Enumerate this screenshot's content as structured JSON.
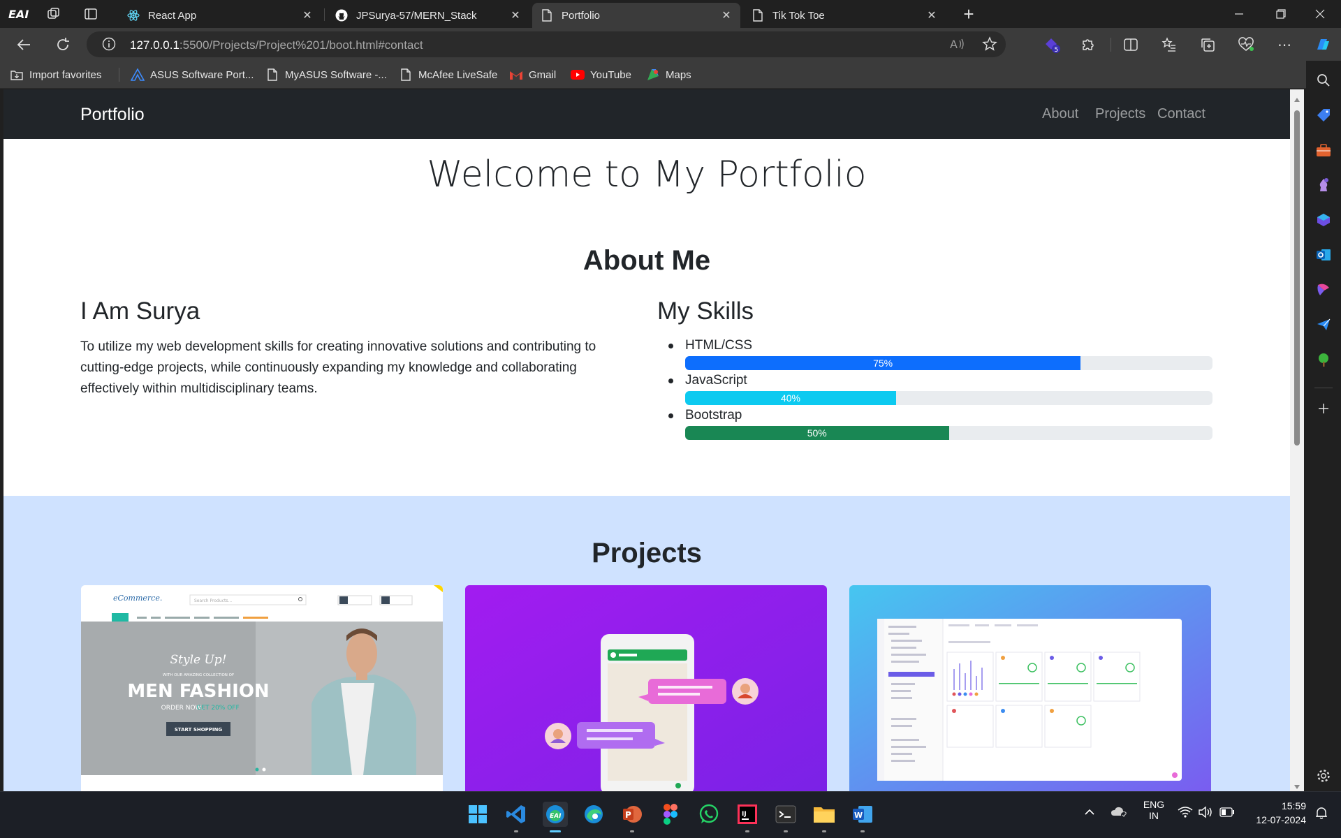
{
  "browser": {
    "tabs": [
      {
        "title": "React App",
        "icon": "react-icon"
      },
      {
        "title": "JPSurya-57/MERN_Stack",
        "icon": "github-icon"
      },
      {
        "title": "Portfolio",
        "icon": "page-icon",
        "active": true
      },
      {
        "title": "Tik Tok Toe",
        "icon": "page-icon"
      }
    ],
    "new_tab_symbol": "+",
    "address": {
      "host": "127.0.0.1",
      "path": ":5500/Projects/Project%201/boot.html#contact"
    },
    "extension_badge": "5",
    "favorites": [
      {
        "label": "Import favorites",
        "icon": "import-icon"
      },
      {
        "label": "ASUS Software Port...",
        "icon": "asus-icon"
      },
      {
        "label": "MyASUS Software -...",
        "icon": "page-icon"
      },
      {
        "label": "McAfee LiveSafe",
        "icon": "page-icon"
      },
      {
        "label": "Gmail",
        "icon": "gmail-icon"
      },
      {
        "label": "YouTube",
        "icon": "youtube-icon"
      },
      {
        "label": "Maps",
        "icon": "maps-icon"
      }
    ]
  },
  "page": {
    "navbar": {
      "brand": "Portfolio",
      "links": [
        "About",
        "Projects",
        "Contact"
      ]
    },
    "hero_title": "Welcome to My Portfolio",
    "about": {
      "heading": "About Me",
      "intro_heading": "I Am Surya",
      "intro_text": "To utilize my web development skills for creating innovative solutions and contributing to cutting-edge projects, while continuously expanding my knowledge and collaborating effectively within multidisciplinary teams.",
      "skills_heading": "My Skills",
      "skills": [
        {
          "name": "HTML/CSS",
          "level": 75,
          "label": "75%",
          "color": "#0d6efd"
        },
        {
          "name": "JavaScript",
          "level": 40,
          "label": "40%",
          "color": "#0dcaf0"
        },
        {
          "name": "Bootstrap",
          "level": 50,
          "label": "50%",
          "color": "#198754"
        }
      ]
    },
    "projects": {
      "heading": "Projects",
      "cards": [
        {
          "type": "ecommerce-screenshot",
          "logo": "eCommerce.",
          "search_placeholder": "Search Products...",
          "tagline": "Style Up!",
          "subline": "WITH OUR AMAZING COLLECTION OF",
          "headline": "MEN FASHION",
          "order_text": "ORDER NOW,",
          "offer_text": "GET 20% OFF",
          "cta": "START SHOPPING"
        },
        {
          "type": "chat-app-illustration"
        },
        {
          "type": "dashboard-screenshot"
        }
      ]
    }
  },
  "taskbar": {
    "apps": [
      "windows-start",
      "vscode",
      "edge-eai",
      "edge",
      "powerpoint",
      "figma",
      "whatsapp",
      "intellij",
      "terminal",
      "file-explorer",
      "word"
    ],
    "language": "ENG",
    "region": "IN",
    "time": "15:59",
    "date": "12-07-2024"
  },
  "colors": {
    "navbar_bg": "#212529",
    "projects_bg": "#cfe2ff",
    "chrome_dark": "#202020",
    "chrome_mid": "#3b3b3b"
  }
}
